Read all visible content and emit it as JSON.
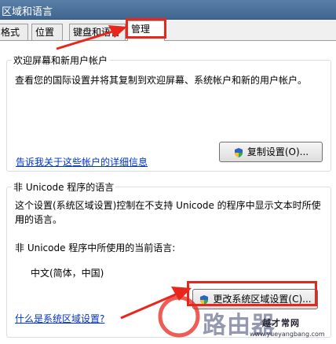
{
  "window": {
    "title": "区域和语言"
  },
  "tabs": [
    {
      "label": "格式"
    },
    {
      "label": "位置"
    },
    {
      "label": "键盘和语言"
    },
    {
      "label": "管理"
    }
  ],
  "welcome_group": {
    "title": "欢迎屏幕和新用户帐户",
    "description": "查看您的国际设置并将其复制到欢迎屏幕、系统帐户和新的用户帐户。",
    "copy_button": "复制设置(O)...",
    "link": "告诉我关于这些帐户的详细信息"
  },
  "unicode_group": {
    "title": "非 Unicode 程序的语言",
    "description_line1": "这个设置(系统区域设置)控制在不支持 Unicode 的程序中显示文本时所使用",
    "description_line2": "用的语言。",
    "current_label": "非 Unicode 程序中所使用的当前语言:",
    "current_value": "中文(简体，中国)",
    "change_button": "更改系统区域设置(C)...",
    "link": "什么是系统区域设置?"
  },
  "watermark": {
    "text": "路由器",
    "brand": "越才常网",
    "url": "www.yueyangbang.com"
  },
  "colors": {
    "highlight": "#e8261c",
    "link": "#0033cc",
    "titlebar": "#4a7099"
  }
}
